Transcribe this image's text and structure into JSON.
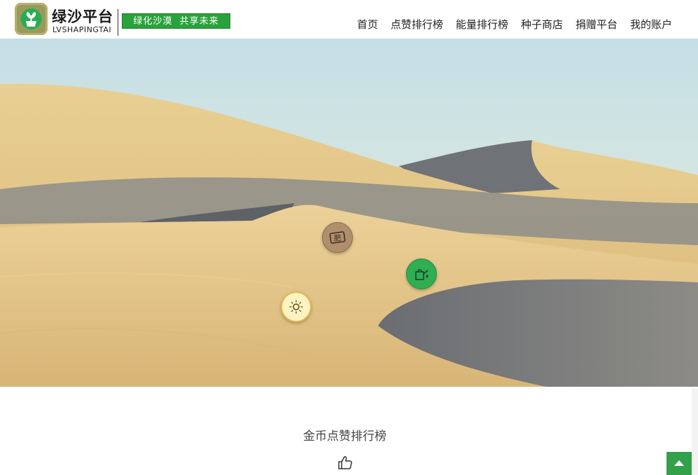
{
  "brand": {
    "name": "绿沙平台",
    "sub": "LVSHAPINGTAI",
    "slogan": "绿化沙漠  共享未来"
  },
  "nav": {
    "items": [
      "首页",
      "点赞排行榜",
      "能量排行榜",
      "种子商店",
      "捐赠平台",
      "我的账户"
    ]
  },
  "hero": {
    "actions": [
      {
        "icon": "fertilizer-icon",
        "label": "肥"
      },
      {
        "icon": "watering-can-icon"
      },
      {
        "icon": "sun-icon"
      }
    ]
  },
  "section": {
    "title": "金币点赞排行榜",
    "icon": "thumbs-up-icon"
  },
  "colors": {
    "brand_green": "#2aa23c",
    "back_to_top": "#33a04a",
    "sand": "#e3c37c",
    "sky": "#cfe4e6"
  }
}
